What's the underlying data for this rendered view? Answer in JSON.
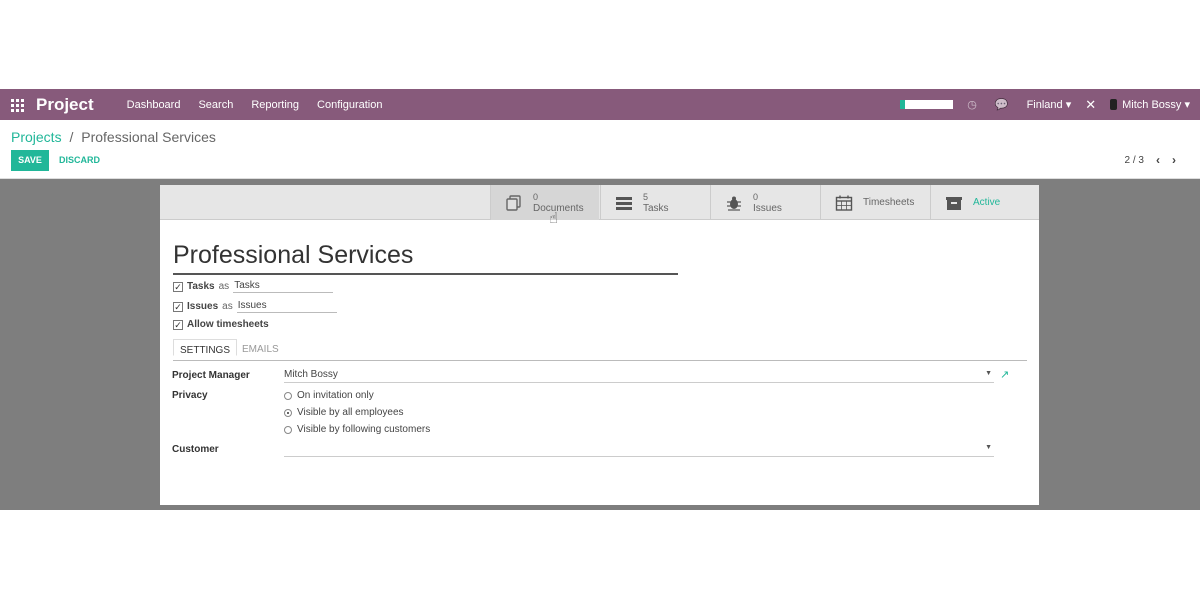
{
  "navbar": {
    "apps_icon": "grid-icon",
    "brand": "Project",
    "menu": [
      "Dashboard",
      "Search",
      "Reporting",
      "Configuration"
    ],
    "company": "Finland ▾",
    "user": "Mitch Bossy ▾"
  },
  "breadcrumb": {
    "parent": "Projects",
    "separator": "/",
    "current": "Professional Services"
  },
  "actions": {
    "save": "SAVE",
    "discard": "DISCARD"
  },
  "pager": {
    "value": "2 / 3",
    "prev": "‹",
    "next": "›"
  },
  "smart_buttons": [
    {
      "count": "0",
      "label": "Documents",
      "icon": "documents-icon"
    },
    {
      "count": "5",
      "label": "Tasks",
      "icon": "tasks-icon"
    },
    {
      "count": "0",
      "label": "Issues",
      "icon": "bug-icon"
    },
    {
      "count": "",
      "label": "Timesheets",
      "icon": "calendar-icon"
    },
    {
      "count": "",
      "label": "Active",
      "icon": "archive-icon"
    }
  ],
  "record": {
    "title": "Professional Services",
    "options": [
      {
        "label": "Tasks",
        "as": "as",
        "alias": "Tasks",
        "checked": true
      },
      {
        "label": "Issues",
        "as": "as",
        "alias": "Issues",
        "checked": true
      },
      {
        "label": "Allow timesheets",
        "checked": true
      }
    ]
  },
  "tabs": [
    "SETTINGS",
    "EMAILS"
  ],
  "fields": {
    "project_manager_label": "Project Manager",
    "project_manager_value": "Mitch Bossy",
    "privacy_label": "Privacy",
    "privacy_options": [
      {
        "label": "On invitation only",
        "selected": false
      },
      {
        "label": "Visible by all employees",
        "selected": true
      },
      {
        "label": "Visible by following customers",
        "selected": false
      }
    ],
    "customer_label": "Customer",
    "customer_value": ""
  },
  "colors": {
    "navbar": "#875a7b",
    "accent": "#21b799"
  }
}
